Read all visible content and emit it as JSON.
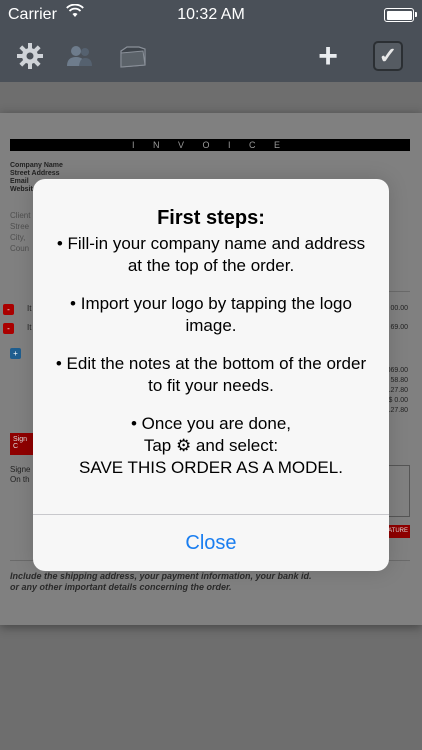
{
  "status_bar": {
    "carrier": "Carrier",
    "time": "10:32 AM",
    "battery_level": 1.0
  },
  "toolbar": {
    "icons": [
      "gear-icon",
      "user-icon",
      "folder-icon",
      "plus-icon",
      "checkbox-icon"
    ],
    "plus_glyph": "+",
    "check_glyph": "✓"
  },
  "document": {
    "title": "I N V O I C E",
    "company": [
      "Company Name",
      "Street Address",
      "Email",
      "Website"
    ],
    "client_partial": [
      "Client",
      "Stree",
      "City,",
      "Coun"
    ],
    "item_partial": [
      "It",
      "It"
    ],
    "amounts_partial": [
      "00.00",
      "69.00",
      ".069.00",
      "$ 58.80",
      ".127.80",
      "$ 0.00",
      "127.80"
    ],
    "sign_partial": [
      "Sign",
      "C"
    ],
    "signed_partial": [
      "Signe",
      "On th"
    ],
    "signature_button_partial": "ATURE",
    "notes": [
      "Include the shipping address, your payment information, your bank id.",
      "or any other important details concerning the order."
    ]
  },
  "alert": {
    "title": "First steps:",
    "items": [
      "• Fill-in your company name and address at the top of the order.",
      "• Import your logo by tapping the logo image.",
      "• Edit the notes at the bottom of the order to fit your needs."
    ],
    "final_line1": "• Once you are done,",
    "final_line2": "Tap ⚙ and select:",
    "final_line3": "SAVE THIS ORDER AS A MODEL.",
    "close_label": "Close"
  },
  "colors": {
    "toolbar_bg": "#4a5058",
    "accent_blue": "#1a7ef0",
    "doc_red": "#8f0000"
  }
}
